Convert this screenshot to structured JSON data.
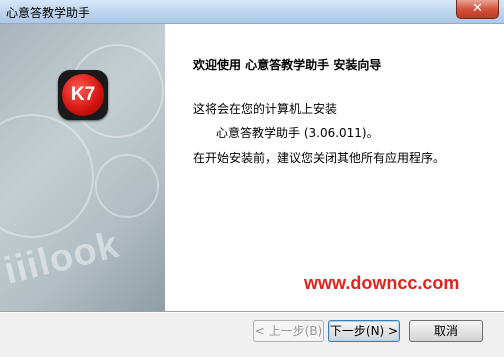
{
  "window": {
    "title": "心意答教学助手",
    "close_label": "✕"
  },
  "sidebar": {
    "logo_text": "K7",
    "watermark": "iiilook"
  },
  "content": {
    "heading": "欢迎使用 心意答教学助手 安装向导",
    "line1": "这将会在您的计算机上安装",
    "line2": "心意答教学助手 (3.06.011)。",
    "line3": "在开始安装前，建议您关闭其他所有应用程序。",
    "site_watermark": "www.downcc.com"
  },
  "buttons": {
    "back_label": "< 上一步(B)",
    "back_enabled": false,
    "next_label": "下一步(N) >",
    "cancel_label": "取消"
  },
  "colors": {
    "accent_red": "#d0120d",
    "site_red": "#e0231c",
    "title_bar": "#bcd4ee"
  }
}
